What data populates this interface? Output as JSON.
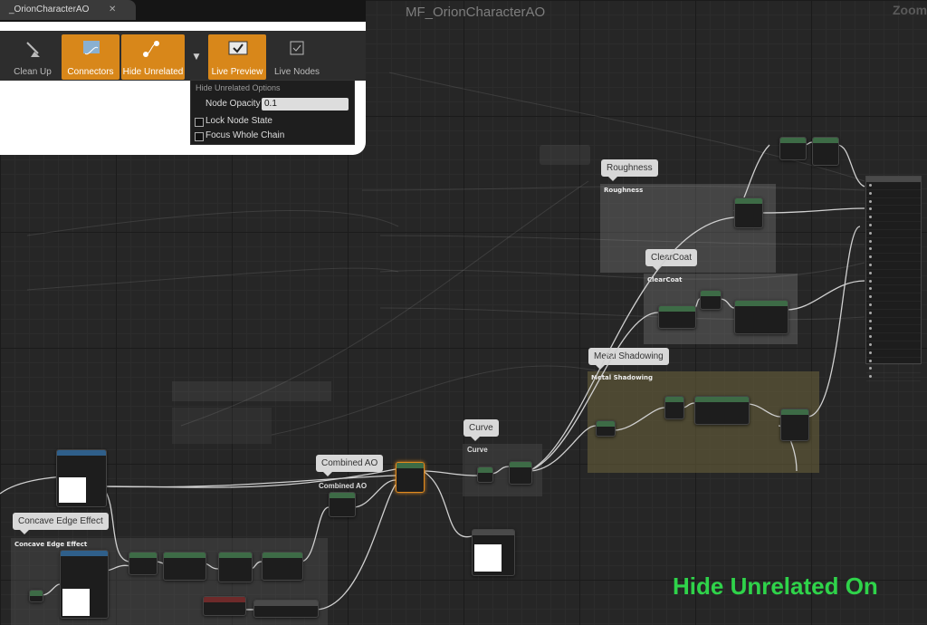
{
  "editor": {
    "tab_title": "_OrionCharacterAO",
    "graph_title": "MF_OrionCharacterAO",
    "zoom_label": "Zoom"
  },
  "toolbar": {
    "buttons": [
      {
        "label": "Clean Up",
        "icon": "broom-icon"
      },
      {
        "label": "Connectors",
        "icon": "connectors-icon"
      },
      {
        "label": "Hide Unrelated",
        "icon": "hide-unrelated-icon"
      },
      {
        "label": "Live Preview",
        "icon": "monitor-icon"
      },
      {
        "label": "Live Nodes",
        "icon": "live-nodes-icon"
      }
    ],
    "active_color": "#d8871a"
  },
  "hide_unrelated_menu": {
    "heading": "Hide Unrelated Options",
    "opacity_label": "Node Opacity",
    "opacity_value": "0.1",
    "lock_label": "Lock Node State",
    "focus_label": "Focus Whole Chain"
  },
  "comments": {
    "roughness": {
      "bubble": "Roughness",
      "title": "Roughness"
    },
    "clearcoat": {
      "bubble": "ClearCoat",
      "title": "ClearCoat"
    },
    "metal": {
      "bubble": "Metal Shadowing",
      "title": "Metal Shadowing"
    },
    "curve": {
      "bubble": "Curve",
      "title": "Curve"
    },
    "combined": {
      "bubble": "Combined AO",
      "title": "Combined AO"
    },
    "concave": {
      "bubble": "Concave Edge Effect",
      "title": "Concave Edge Effect"
    }
  },
  "overlay": {
    "text": "Hide Unrelated On",
    "color": "#2fd34a"
  }
}
